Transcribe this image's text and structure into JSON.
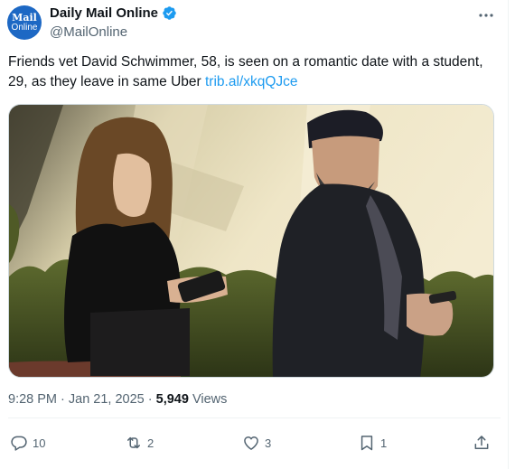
{
  "author": {
    "avatar_line1": "Mail",
    "avatar_line2": "Online",
    "display_name": "Daily Mail Online",
    "handle": "@MailOnline"
  },
  "tweet": {
    "text": "Friends vet David Schwimmer, 58, is seen on a romantic date with a student, 29, as they leave in same Uber",
    "link_text": "trib.al/xkqQJce",
    "timestamp": "9:28 PM · Jan 21, 2025 · ",
    "views_count": "5,949",
    "views_label": " Views"
  },
  "actions": {
    "replies": "10",
    "reposts": "2",
    "likes": "3",
    "bookmarks": "1"
  },
  "icons": {
    "verified": "verified-badge-icon",
    "more": "more-icon",
    "reply": "reply-icon",
    "repost": "repost-icon",
    "like": "heart-icon",
    "bookmark": "bookmark-icon",
    "share": "share-icon"
  },
  "colors": {
    "link": "#1d9bf0",
    "secondary_text": "#536471",
    "avatar_bg": "#1d68c4"
  }
}
